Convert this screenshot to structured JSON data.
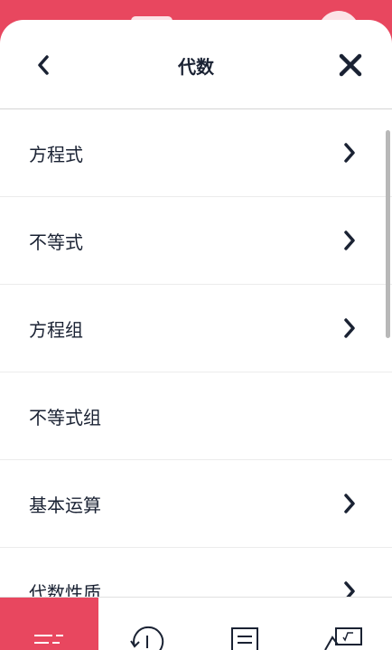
{
  "header": {
    "title": "代数",
    "back_icon": "chevron-left-icon",
    "close_icon": "close-icon"
  },
  "list": {
    "items": [
      {
        "label": "方程式",
        "has_chevron": true
      },
      {
        "label": "不等式",
        "has_chevron": true
      },
      {
        "label": "方程组",
        "has_chevron": true
      },
      {
        "label": "不等式组",
        "has_chevron": false
      },
      {
        "label": "基本运算",
        "has_chevron": true
      },
      {
        "label": "代数性质",
        "has_chevron": true
      }
    ]
  },
  "tabbar": {
    "tabs": [
      {
        "icon": "menu-icon",
        "active": true
      },
      {
        "icon": "history-icon",
        "active": false
      },
      {
        "icon": "notes-icon",
        "active": false
      },
      {
        "icon": "calculator-board-icon",
        "active": false
      }
    ]
  },
  "colors": {
    "accent": "#e8475f",
    "text": "#1a2233",
    "divider": "#ececec"
  }
}
